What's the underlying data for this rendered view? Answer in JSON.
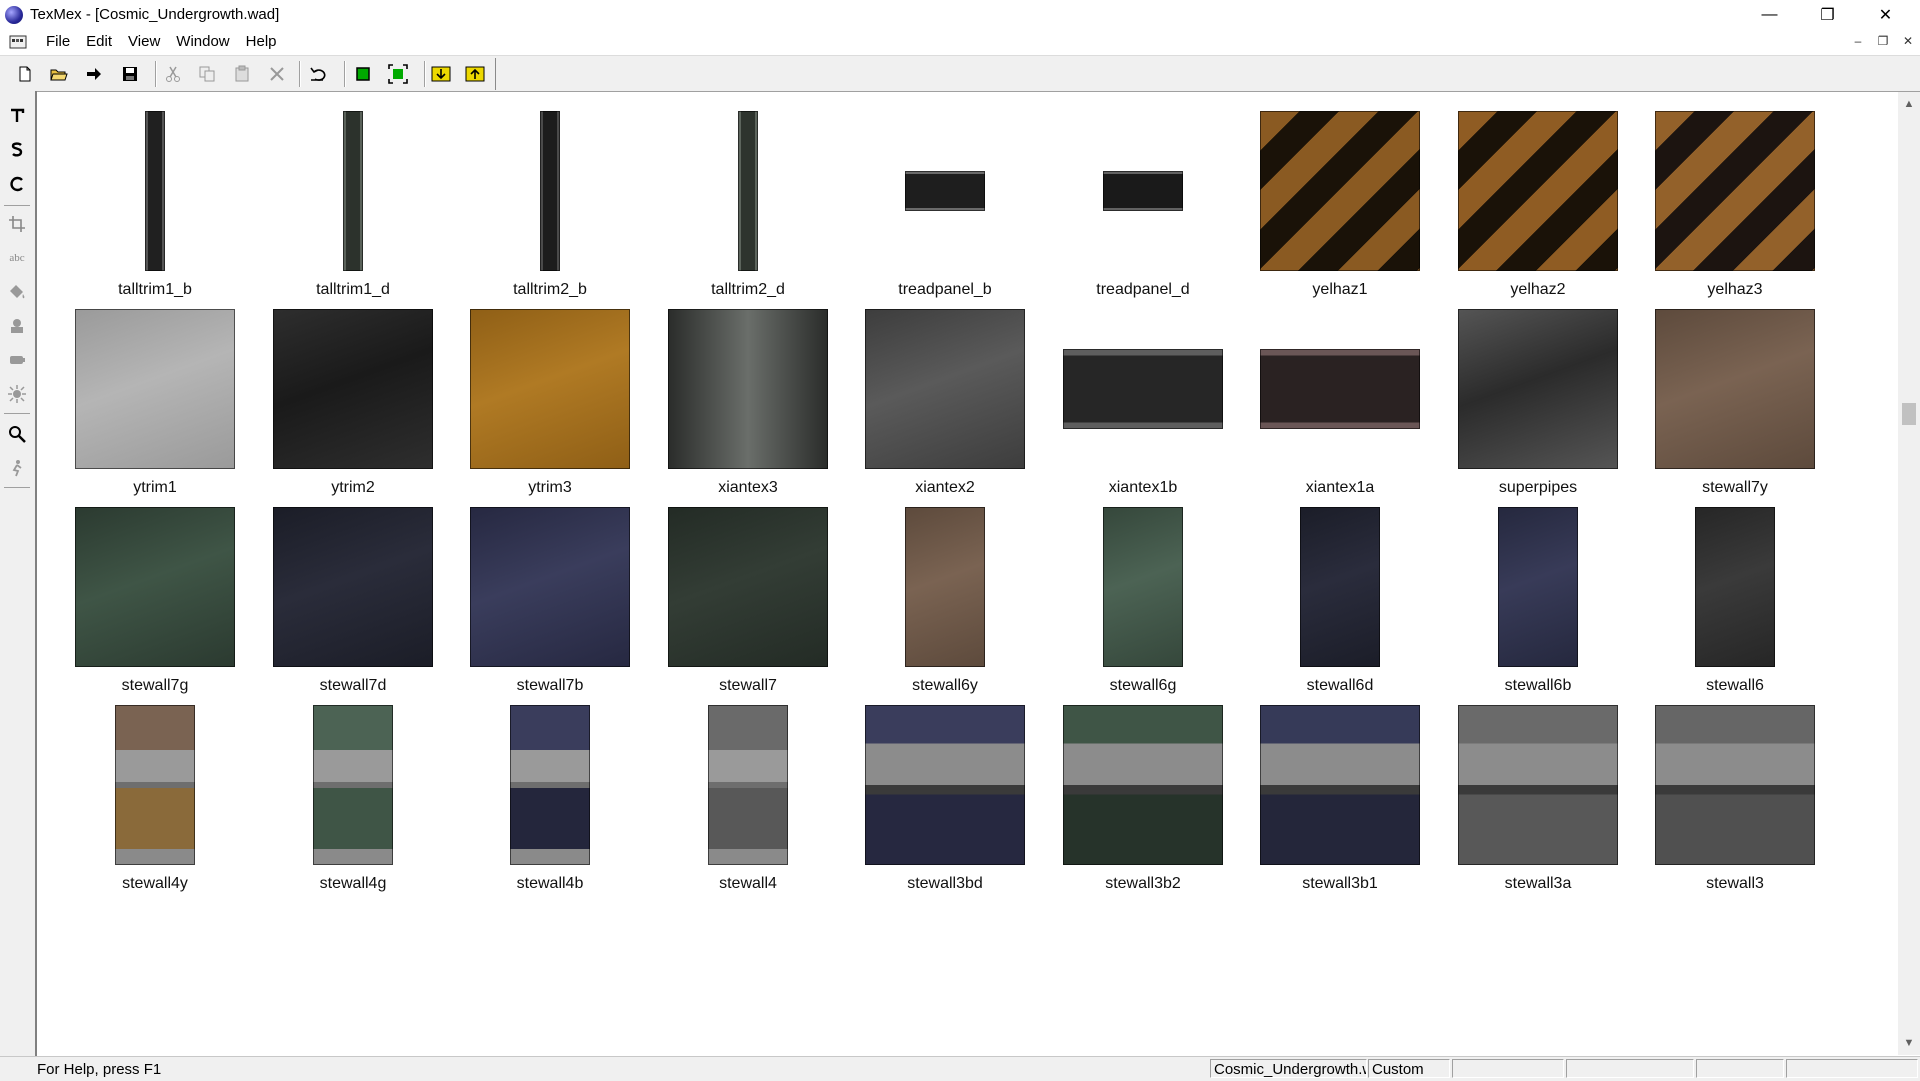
{
  "window": {
    "title": "TexMex - [Cosmic_Undergrowth.wad]",
    "minimize": "—",
    "restore": "❐",
    "close": "✕"
  },
  "menu": [
    "File",
    "Edit",
    "View",
    "Window",
    "Help"
  ],
  "mdi_controls": [
    "–",
    "❐",
    "✕"
  ],
  "toolbar": {
    "buttons": [
      "new-document-icon",
      "open-folder-icon",
      "arrow-right-icon",
      "save-icon",
      "cut-icon",
      "copy-icon",
      "paste-icon",
      "delete-icon",
      "undo-icon",
      "green-square-icon",
      "fit-frame-icon",
      "import-icon",
      "export-icon"
    ]
  },
  "palette": {
    "tools": [
      "text-tool-icon",
      "s-tool-icon",
      "c-tool-icon",
      "crop-icon",
      "abc-text-icon",
      "bucket-icon",
      "stamp-icon",
      "brush-icon",
      "sun-icon",
      "zoom-icon",
      "figure-icon"
    ],
    "abc_label": "abc"
  },
  "textures": [
    {
      "name": "talltrim1_b",
      "kind": "tall",
      "base": "#202020",
      "edge": "#555555"
    },
    {
      "name": "talltrim1_d",
      "kind": "tall",
      "base": "#2c322c",
      "edge": "#5a625a"
    },
    {
      "name": "talltrim2_b",
      "kind": "tall",
      "base": "#1c1c1c",
      "edge": "#4a4a4a"
    },
    {
      "name": "talltrim2_d",
      "kind": "tall",
      "base": "#2e342e",
      "edge": "#5d655d"
    },
    {
      "name": "treadpanel_b",
      "kind": "small",
      "base": "#1e1e1e",
      "edge": "#6a6a6a"
    },
    {
      "name": "treadpanel_d",
      "kind": "small",
      "base": "#1a1a1a",
      "edge": "#626262"
    },
    {
      "name": "yelhaz1",
      "kind": "hazard",
      "base": "#1a1208",
      "edge": "#8a5a22"
    },
    {
      "name": "yelhaz2",
      "kind": "hazard",
      "base": "#1a1208",
      "edge": "#8f5c23"
    },
    {
      "name": "yelhaz3",
      "kind": "hazard",
      "base": "#1c1410",
      "edge": "#93612a"
    },
    {
      "name": "ytrim1",
      "kind": "square",
      "base": "#b5b5b5",
      "edge": "#9a9a9a"
    },
    {
      "name": "ytrim2",
      "kind": "square",
      "base": "#1a1a1a",
      "edge": "#2e2e2e"
    },
    {
      "name": "ytrim3",
      "kind": "square",
      "base": "#b07a24",
      "edge": "#8f5f16"
    },
    {
      "name": "xiantex3",
      "kind": "metal",
      "base": "#2a2c2a",
      "edge": "#6a6e6a"
    },
    {
      "name": "xiantex2",
      "kind": "square",
      "base": "#5a5a5a",
      "edge": "#3d3d3d"
    },
    {
      "name": "xiantex1b",
      "kind": "wide",
      "base": "#262626",
      "edge": "#5e5e5e"
    },
    {
      "name": "xiantex1a",
      "kind": "wide",
      "base": "#2a2222",
      "edge": "#6a5656"
    },
    {
      "name": "superpipes",
      "kind": "square",
      "base": "#2b2b2b",
      "edge": "#555555"
    },
    {
      "name": "stewall7y",
      "kind": "square",
      "base": "#7a6352",
      "edge": "#5d4a3c"
    },
    {
      "name": "stewall7g",
      "kind": "square",
      "base": "#3f5546",
      "edge": "#2b3a30"
    },
    {
      "name": "stewall7d",
      "kind": "square",
      "base": "#2a2c3a",
      "edge": "#1b1d27"
    },
    {
      "name": "stewall7b",
      "kind": "square",
      "base": "#3a3d5c",
      "edge": "#262841"
    },
    {
      "name": "stewall7",
      "kind": "square",
      "base": "#333d35",
      "edge": "#232b25"
    },
    {
      "name": "stewall6y",
      "kind": "half",
      "base": "#7a6352",
      "edge": "#5d4a3c"
    },
    {
      "name": "stewall6g",
      "kind": "half",
      "base": "#4c6354",
      "edge": "#35473b"
    },
    {
      "name": "stewall6d",
      "kind": "half",
      "base": "#2a2c3c",
      "edge": "#1b1d28"
    },
    {
      "name": "stewall6b",
      "kind": "half",
      "base": "#383b58",
      "edge": "#25283e"
    },
    {
      "name": "stewall6",
      "kind": "half",
      "base": "#3a3a3a",
      "edge": "#262626"
    },
    {
      "name": "stewall4y",
      "kind": "halfsplit",
      "base": "#8a6a3a",
      "edge": "#7a6352"
    },
    {
      "name": "stewall4g",
      "kind": "halfsplit",
      "base": "#3f5546",
      "edge": "#4c6354"
    },
    {
      "name": "stewall4b",
      "kind": "halfsplit",
      "base": "#24263c",
      "edge": "#3a3d5c"
    },
    {
      "name": "stewall4",
      "kind": "halfsplit",
      "base": "#585858",
      "edge": "#6a6a6a"
    },
    {
      "name": "stewall3bd",
      "kind": "panel",
      "base": "#262840",
      "edge": "#3a3d5c"
    },
    {
      "name": "stewall3b2",
      "kind": "panel",
      "base": "#26332a",
      "edge": "#3f5546"
    },
    {
      "name": "stewall3b1",
      "kind": "panel",
      "base": "#24263a",
      "edge": "#363a58"
    },
    {
      "name": "stewall3a",
      "kind": "panel",
      "base": "#585858",
      "edge": "#6a6a6a"
    },
    {
      "name": "stewall3",
      "kind": "panel",
      "base": "#505050",
      "edge": "#666666"
    }
  ],
  "status": {
    "help": "For Help, press F1",
    "file": "Cosmic_Undergrowth.wad",
    "mode": "Custom"
  }
}
